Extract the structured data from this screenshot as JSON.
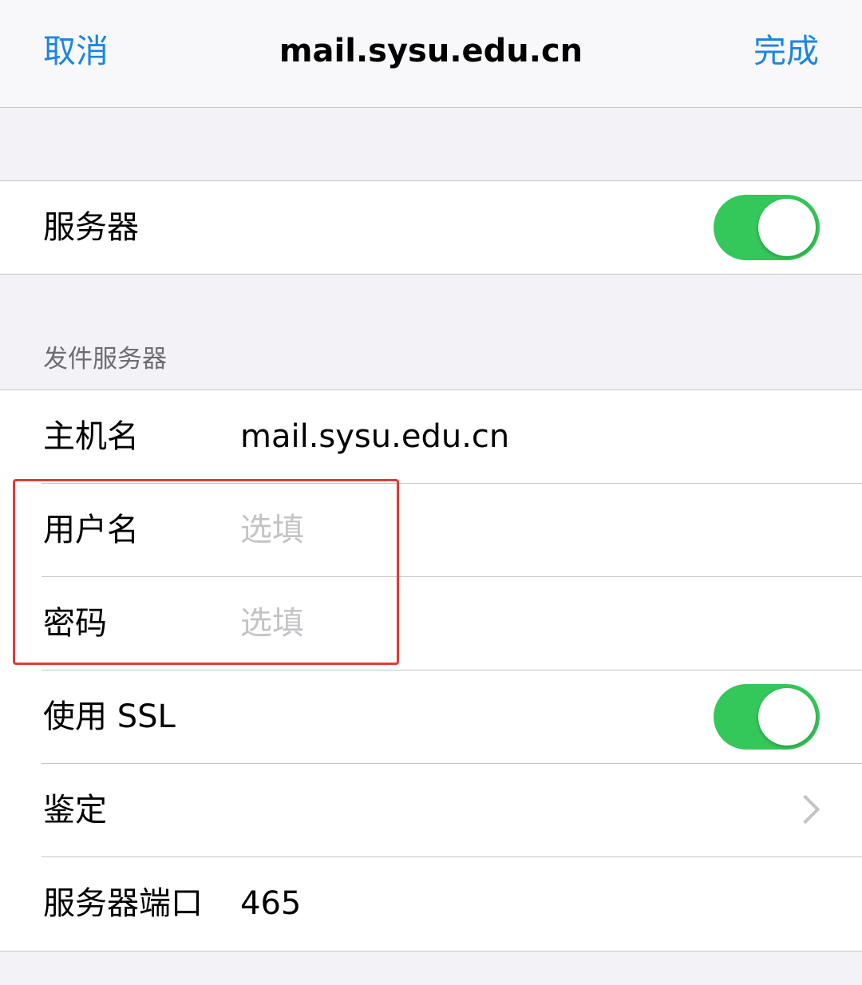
{
  "navbar": {
    "cancel_label": "取消",
    "title": "mail.sysu.edu.cn",
    "done_label": "完成"
  },
  "server_toggle": {
    "label": "服务器",
    "enabled": true
  },
  "outgoing_section": {
    "header": "发件服务器",
    "host_label": "主机名",
    "host_value": "mail.sysu.edu.cn",
    "username_label": "用户名",
    "username_placeholder": "选填",
    "password_label": "密码",
    "password_placeholder": "选填",
    "ssl_label": "使用 SSL",
    "ssl_enabled": true,
    "auth_label": "鉴定",
    "port_label": "服务器端口",
    "port_value": "465"
  },
  "colors": {
    "accent": "#1c84e6",
    "toggle_on": "#34c759",
    "highlight": "#e53935",
    "background": "#f2f2f7",
    "placeholder": "#c4c4c7"
  }
}
